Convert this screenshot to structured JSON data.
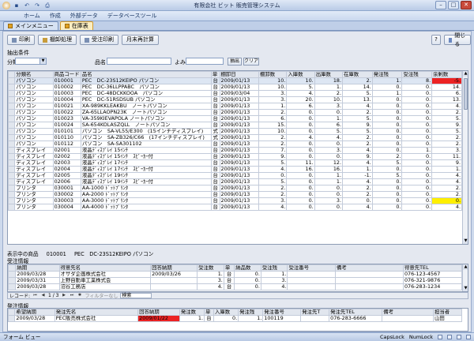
{
  "app": {
    "title": "有限会社 ビット 販売管理システム"
  },
  "ribbon": {
    "tabs": [
      "ホーム",
      "作成",
      "外部データ",
      "データベースツール"
    ]
  },
  "doc_tabs": [
    {
      "label": "メインメニュー"
    },
    {
      "label": "在庫表"
    }
  ],
  "toolbar": {
    "print": "印刷",
    "stocktake": "棚卸処理",
    "order_print": "受注印刷",
    "month_calc": "月末再計算",
    "help": "?",
    "close": "閉じる"
  },
  "filter": {
    "header": "抽出条件",
    "category_label": "分類",
    "category_value": "",
    "name_label": "品名",
    "name_value": "",
    "reading_label": "よみ",
    "reading_value": "",
    "extract_button": "抽出",
    "clear_button": "クリア"
  },
  "colors": {
    "accent": "#fbeec2",
    "alert": "#ec2323",
    "warning": "#ffef00"
  },
  "inventory": {
    "columns": [
      "分類名",
      "商品コード",
      "品名",
      "単",
      "棚卸日",
      "棚卸数",
      "入庫数",
      "出庫数",
      "在庫数",
      "発注残",
      "受注残",
      "余剰数"
    ],
    "rows": [
      [
        "パソコン",
        "010001",
        "PEC　DC-23S12KEIPO パソコン",
        "台",
        "2009/01/13",
        "10.",
        "10.",
        "18.",
        "2.",
        "1.",
        "8.",
        "-5."
      ],
      [
        "パソコン",
        "010002",
        "PEC　DC-36LLPPABC　パソコン",
        "台",
        "2009/01/13",
        "10.",
        "5.",
        "1.",
        "14.",
        "0.",
        "0.",
        "14."
      ],
      [
        "パソコン",
        "010003",
        "PEC　DC-48DCKKOOA　パソコン",
        "台",
        "2009/03/04",
        "3.",
        "4.",
        "2.",
        "5.",
        "1.",
        "0.",
        "6."
      ],
      [
        "パソコン",
        "010004",
        "PEC　DC-51RSDSUB パソコン",
        "台",
        "2009/01/13",
        "3.",
        "20.",
        "10.",
        "13.",
        "0.",
        "0.",
        "13."
      ],
      [
        "パソコン",
        "010021",
        "XA-989KKLEAKBU　ノートパソコン",
        "台",
        "2009/01/13",
        "1.",
        "6.",
        "3.",
        "4.",
        "0.",
        "0.",
        "4."
      ],
      [
        "パソコン",
        "010022",
        "ZA-65LLAOPN23K　ノートパソコン",
        "台",
        "2009/01/13",
        "2.",
        "0.",
        "0.",
        "2.",
        "0.",
        "0.",
        "2."
      ],
      [
        "パソコン",
        "010023",
        "VA-359KIEVAPOLA ノートパソコン",
        "台",
        "2009/01/13",
        "6.",
        "0.",
        "1.",
        "5.",
        "0.",
        "0.",
        "5."
      ],
      [
        "パソコン",
        "010024",
        "SA-654KOLASZQLL　ノートパソコン",
        "台",
        "2009/01/13",
        "15.",
        "0.",
        "6.",
        "9.",
        "0.",
        "0.",
        "9."
      ],
      [
        "パソコン",
        "010101",
        "パソコン　SA-VL55/E300　(15インチディスプレイ)",
        "式",
        "2009/01/13",
        "10.",
        "0.",
        "5.",
        "5.",
        "0.",
        "0.",
        "5."
      ],
      [
        "パソコン",
        "010110",
        "パソコン　SA-ZB326/C66　(17インチディスプレイ)",
        "式",
        "2009/01/13",
        "2.",
        "4.",
        "4.",
        "2.",
        "0.",
        "0.",
        "2."
      ],
      [
        "パソコン",
        "010112",
        "パソコン　SA-SA301102",
        "台",
        "2009/01/13",
        "2.",
        "0.",
        "0.",
        "2.",
        "0.",
        "0.",
        "2."
      ],
      [
        "ディスプレイ",
        "02001",
        "液晶ﾃﾞｨｽﾌﾟﾚｲ 15ｲﾝﾁ",
        "台",
        "2009/01/13",
        "7.",
        "0.",
        "3.",
        "4.",
        "0.",
        "1.",
        "3."
      ],
      [
        "ディスプレイ",
        "02002",
        "液晶ﾃﾞｨｽﾌﾟﾚｲ 15ｲﾝﾁ　ｽﾋﾟｰｶｰ付",
        "台",
        "2009/01/13",
        "9.",
        "0.",
        "0.",
        "9.",
        "2.",
        "0.",
        "11."
      ],
      [
        "ディスプレイ",
        "02003",
        "液晶ﾃﾞｨｽﾌﾟﾚｲ 17ｲﾝﾁ",
        "台",
        "2009/01/13",
        "5.",
        "11.",
        "12.",
        "4.",
        "5.",
        "0.",
        "9."
      ],
      [
        "ディスプレイ",
        "02004",
        "液晶ﾃﾞｨｽﾌﾟﾚｲ 17ｲﾝﾁ　ｽﾋﾟｰｶｰ付",
        "台",
        "2009/01/13",
        "4.",
        "16.",
        "16.",
        "1.",
        "0.",
        "0.",
        "1."
      ],
      [
        "ディスプレイ",
        "02005",
        "液晶ﾃﾞｨｽﾌﾟﾚｲ 19ｲﾝﾁ",
        "台",
        "2009/01/13",
        "0.",
        "0.",
        "1.",
        "-1.",
        "5.",
        "0.",
        "4."
      ],
      [
        "ディスプレイ",
        "02006",
        "液晶ﾃﾞｨｽﾌﾟﾚｲ 19ｲﾝﾁ　ｽﾋﾟｰｶｰ付",
        "台",
        "2009/01/13",
        "5.",
        "0.",
        "1.",
        "4.",
        "0.",
        "0.",
        "4."
      ],
      [
        "プリンタ",
        "030001",
        "AA-1000 ﾄﾞｯﾄﾌﾟﾘﾝﾀ",
        "台",
        "2009/01/13",
        "2.",
        "0.",
        "0.",
        "2.",
        "0.",
        "0.",
        "2."
      ],
      [
        "プリンタ",
        "030002",
        "AA-2000 ﾄﾞｯﾄﾌﾟﾘﾝﾀ",
        "台",
        "2009/01/13",
        "2.",
        "0.",
        "0.",
        "2.",
        "0.",
        "0.",
        "2."
      ],
      [
        "プリンタ",
        "030003",
        "AA-3000 ﾄﾞｯﾄﾌﾟﾘﾝﾀ",
        "台",
        "2009/01/13",
        "3.",
        "0.",
        "3.",
        "0.",
        "0.",
        "0.",
        "0."
      ],
      [
        "プリンタ",
        "030004",
        "AA-4000 ﾄﾞｯﾄﾌﾟﾘﾝﾀ",
        "台",
        "2009/01/13",
        "4.",
        "0.",
        "0.",
        "4.",
        "0.",
        "0.",
        "4."
      ]
    ]
  },
  "display_item": {
    "label": "表示中の商品",
    "code": "010001",
    "name": "PEC　DC-23S12KEIPO パソコン"
  },
  "orders": {
    "label": "受注情報",
    "columns": [
      "",
      "納期",
      "得意先名",
      "回答納期",
      "受注数",
      "単",
      "納品数",
      "受注残",
      "受注番号",
      "備考",
      "得意先TEL"
    ],
    "rows": [
      [
        "",
        "2009/03/28",
        "オサダ企画株式会社",
        "2009/03/26",
        "1.",
        "台",
        "0.",
        "1.",
        "",
        "",
        "076-123-4567"
      ],
      [
        "",
        "2009/03/31",
        "上野自動車工業株式会",
        "",
        "3.",
        "台",
        "0.",
        "3.",
        "",
        "",
        "076-321-9876"
      ],
      [
        "",
        "2009/03/28",
        "沼谷工務店",
        "",
        "4.",
        "台",
        "0.",
        "4.",
        "",
        "",
        "076-283-1234"
      ]
    ]
  },
  "nav": {
    "record_label": "レコード:",
    "record_pos": "1 / 3",
    "no_filter": "フィルターなし",
    "search": "検索"
  },
  "purchase": {
    "label": "発注情報",
    "columns": [
      "",
      "希望納期",
      "発注先名",
      "回答納期",
      "発注数",
      "単",
      "入庫数",
      "発注残",
      "発注番号",
      "発注先T",
      "発注先TEL",
      "備考",
      "担当者"
    ],
    "rows": [
      [
        "",
        "2009/03/28",
        "PEC販売株式会社",
        "2009/01/22",
        "1.",
        "台",
        "0.",
        "1.",
        "100119",
        "",
        "076-283-6666",
        "",
        "山田"
      ]
    ]
  },
  "status": {
    "left": "フォーム ビュー",
    "caps": "CapsLock",
    "num": "NumLock"
  }
}
